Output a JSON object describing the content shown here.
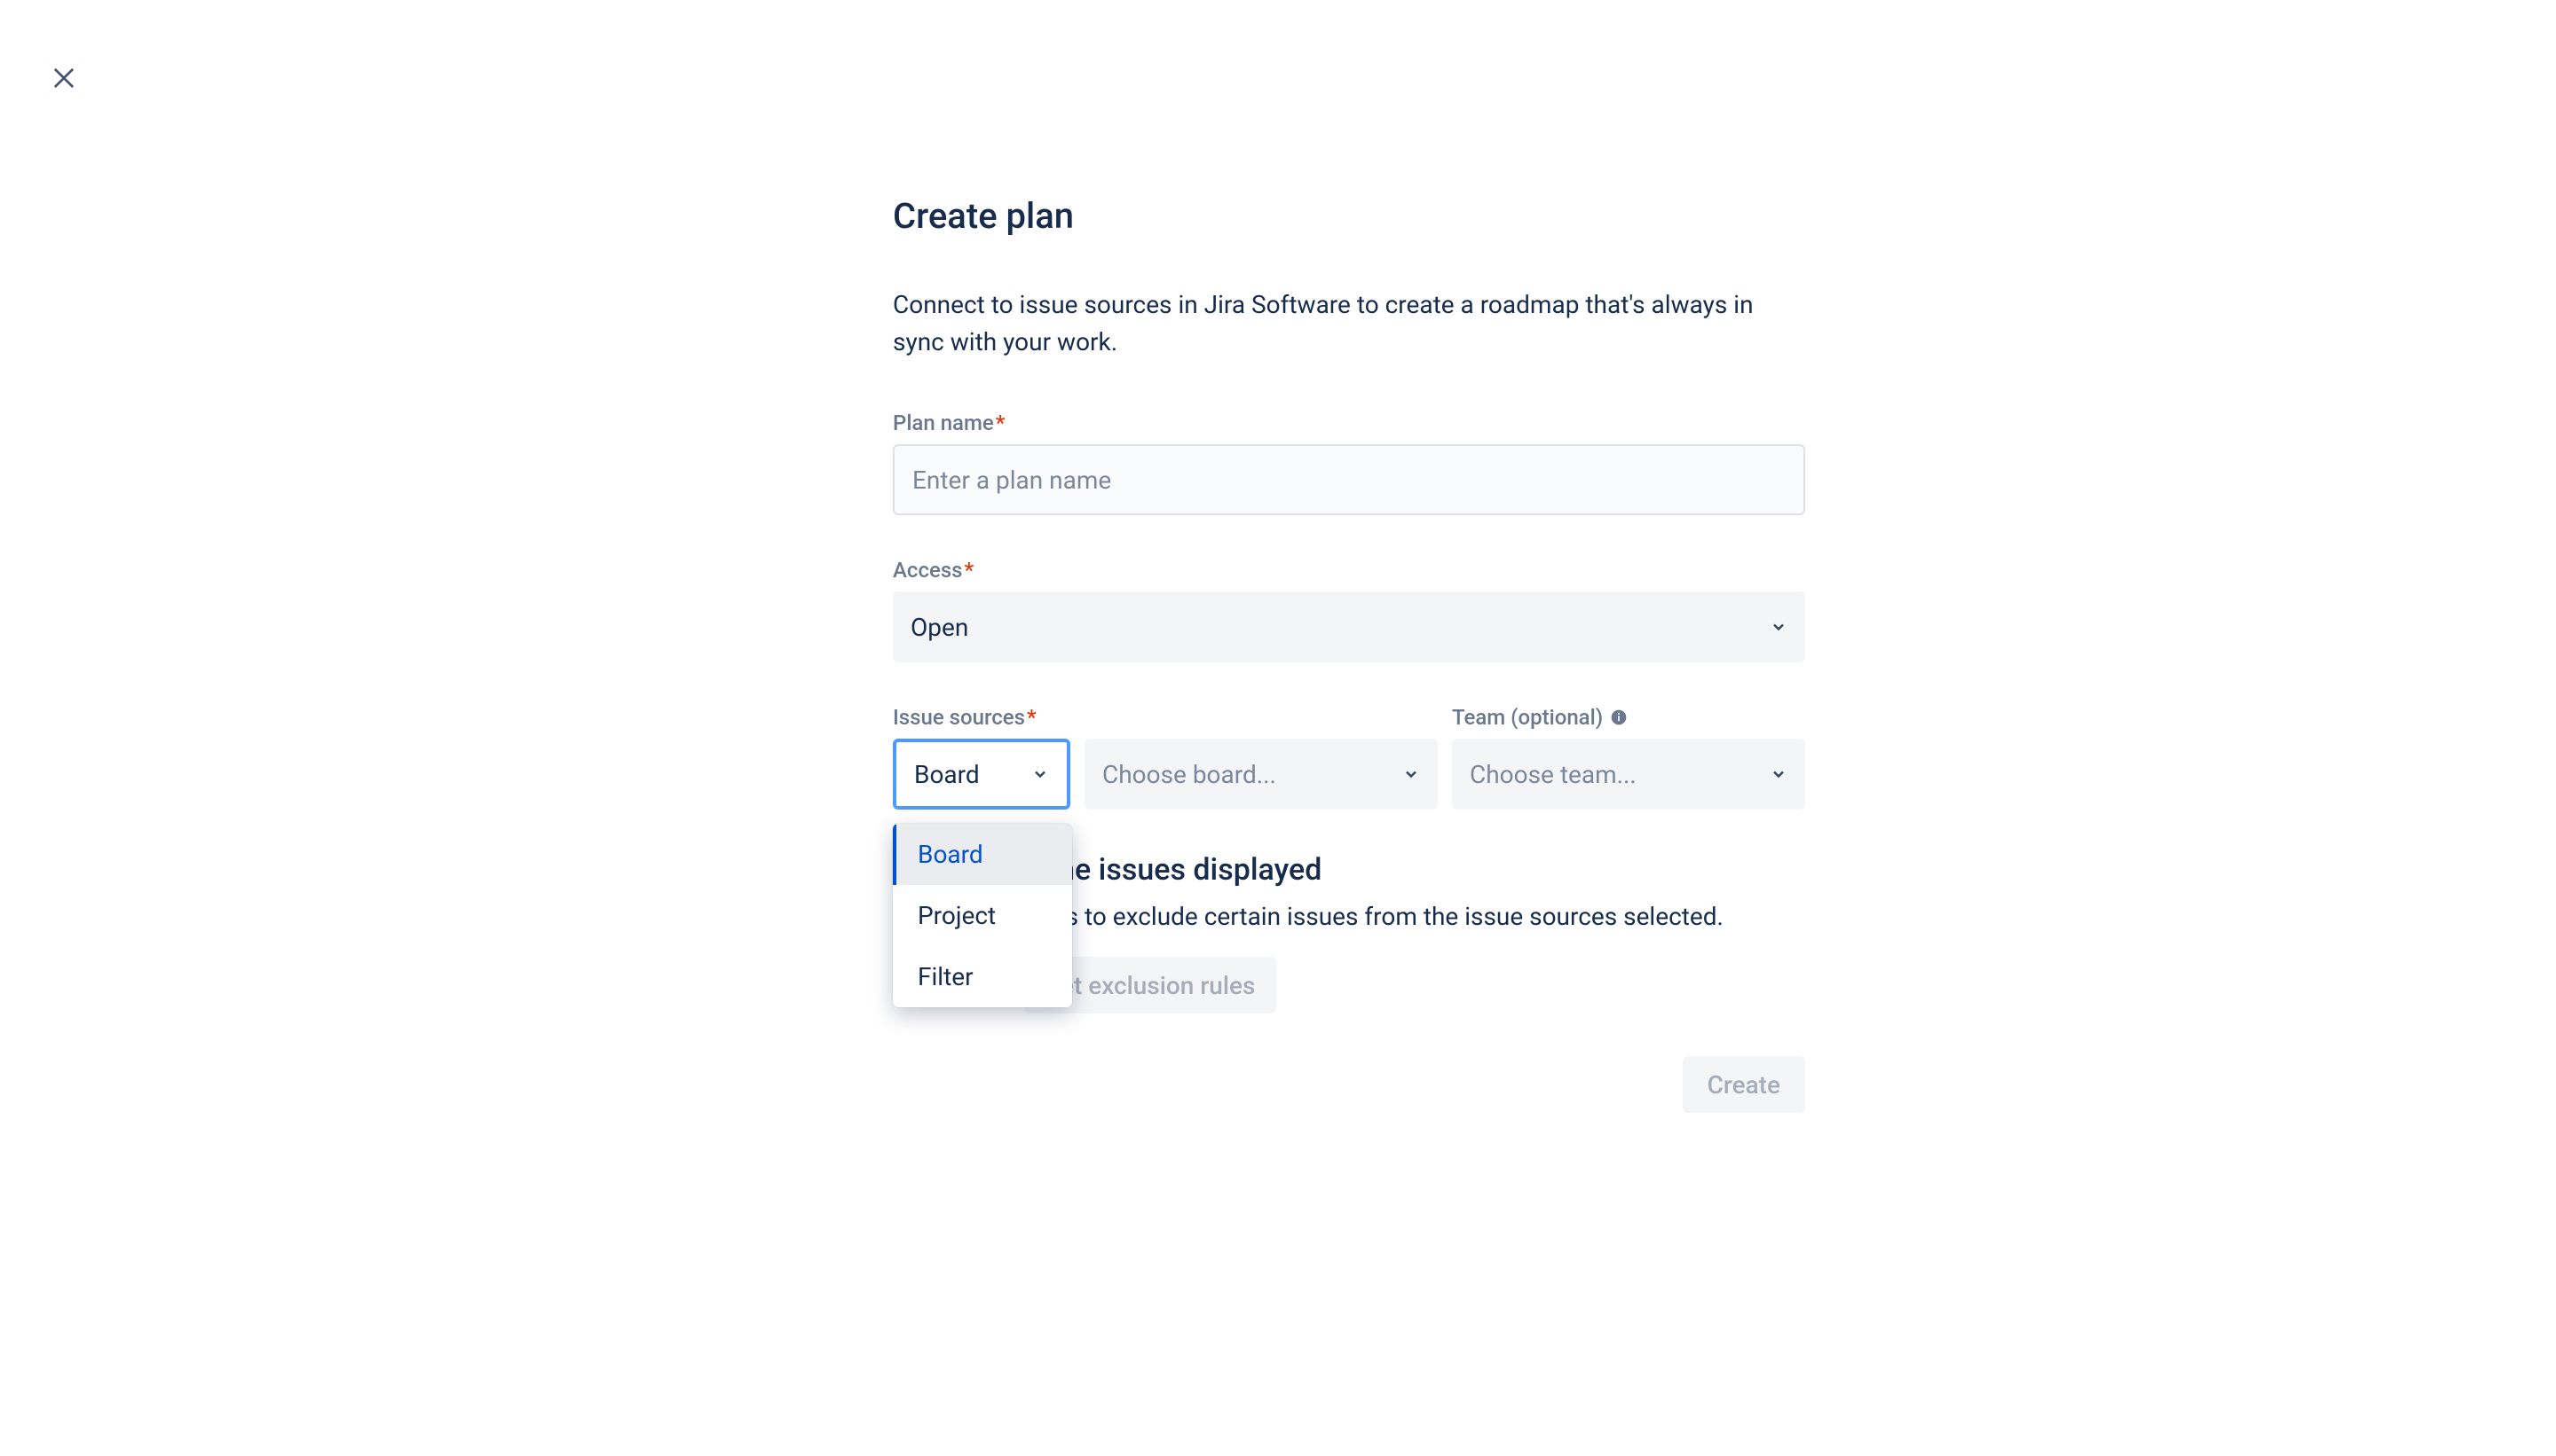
{
  "modal": {
    "title": "Create plan",
    "description": "Connect to issue sources in Jira Software to create a roadmap that's always in sync with your work."
  },
  "form": {
    "planName": {
      "label": "Plan name",
      "placeholder": "Enter a plan name",
      "required": true
    },
    "access": {
      "label": "Access",
      "value": "Open",
      "required": true
    },
    "issueSources": {
      "label": "Issue sources",
      "required": true,
      "sourceType": {
        "value": "Board",
        "options": [
          "Board",
          "Project",
          "Filter"
        ]
      },
      "board": {
        "placeholder": "Choose board..."
      }
    },
    "team": {
      "label": "Team (optional)",
      "placeholder": "Choose team..."
    }
  },
  "refine": {
    "title": "efine issues displayed",
    "description": "rules to exclude certain issues from the issue sources selected.",
    "buttonLabel": "Set exclusion rules"
  },
  "actions": {
    "createLabel": "Create"
  },
  "requiredMark": "*"
}
